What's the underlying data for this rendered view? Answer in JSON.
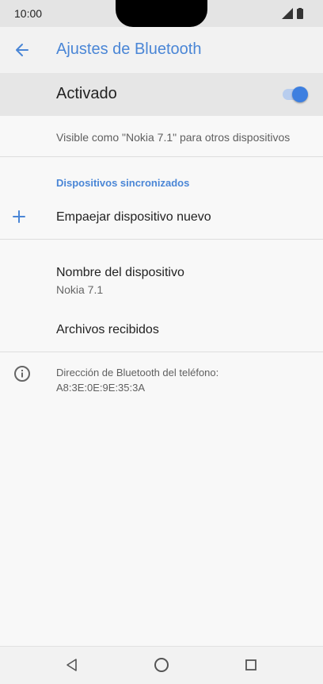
{
  "status_bar": {
    "time": "10:00"
  },
  "app_bar": {
    "title": "Ajustes de Bluetooth",
    "back_icon": "arrow-left-icon"
  },
  "master_switch": {
    "label": "Activado",
    "state": "on",
    "accent_color": "#3d7fe0"
  },
  "visibility_text": "Visible como \"Nokia 7.1\" para otros dispositivos",
  "paired_section": {
    "header": "Dispositivos sincronizados",
    "pair_new_label": "Empaejar dispositivo nuevo"
  },
  "device_name": {
    "title": "Nombre del dispositivo",
    "value": "Nokia 7.1"
  },
  "received_files": {
    "label": "Archivos recibidos"
  },
  "info": {
    "text": "Dirección de Bluetooth del teléfono: A8:3E:0E:9E:35:3A"
  },
  "colors": {
    "accent": "#4a86d6",
    "background": "#f8f8f8",
    "header_bg": "#e6e6e6"
  },
  "icons": [
    "arrow-left-icon",
    "plus-icon",
    "info-icon",
    "nav-back-icon",
    "nav-home-icon",
    "nav-recents-icon"
  ]
}
